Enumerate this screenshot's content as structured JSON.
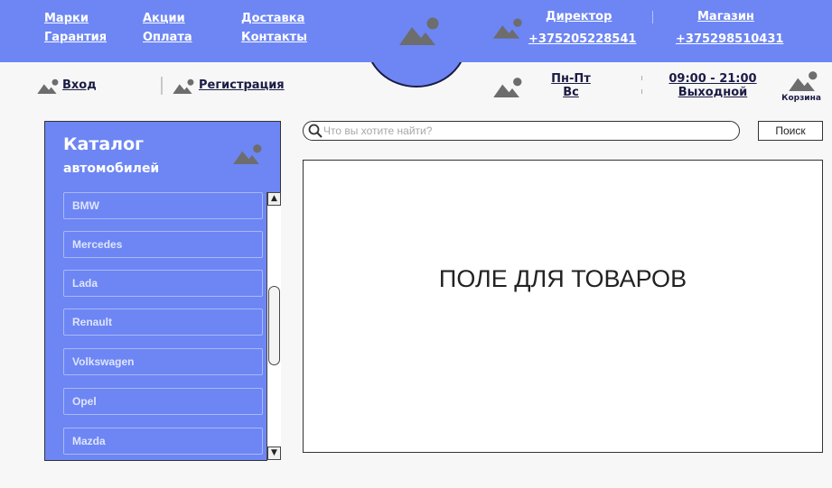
{
  "header": {
    "nav": [
      {
        "label": "Марки"
      },
      {
        "label": "Гарантия"
      },
      {
        "label": "Акции"
      },
      {
        "label": "Оплата"
      },
      {
        "label": "Доставка"
      },
      {
        "label": "Контакты"
      }
    ],
    "contacts": {
      "director": {
        "label": "Директор",
        "phone": "+375205228541"
      },
      "shop": {
        "label": "Магазин",
        "phone": "+375298510431"
      }
    }
  },
  "subheader": {
    "login": "Вход",
    "register": "Регистрация",
    "days_weekday": "Пн-Пт",
    "days_sunday": "Вс",
    "hours_weekday": "09:00 - 21:00",
    "hours_sunday": "Выходной",
    "cart": "Корзина"
  },
  "catalog": {
    "title": "Каталог",
    "subtitle": "автомобилей",
    "items": [
      "BMW",
      "Mercedes",
      "Lada",
      "Renault",
      "Volkswagen",
      "Opel",
      "Mazda"
    ]
  },
  "search": {
    "placeholder": "Что вы хотите найти?",
    "button": "Поиск"
  },
  "products": {
    "label": "ПОЛЕ ДЛЯ ТОВАРОВ"
  },
  "icons": {
    "image_placeholder": "image-placeholder-icon",
    "search": "search-icon",
    "scroll_up": "triangle-up-icon",
    "scroll_down": "triangle-down-icon"
  },
  "colors": {
    "header": "#6d86f4",
    "text_dark": "#1b1b45",
    "icon_gray": "#6d6d6d"
  }
}
